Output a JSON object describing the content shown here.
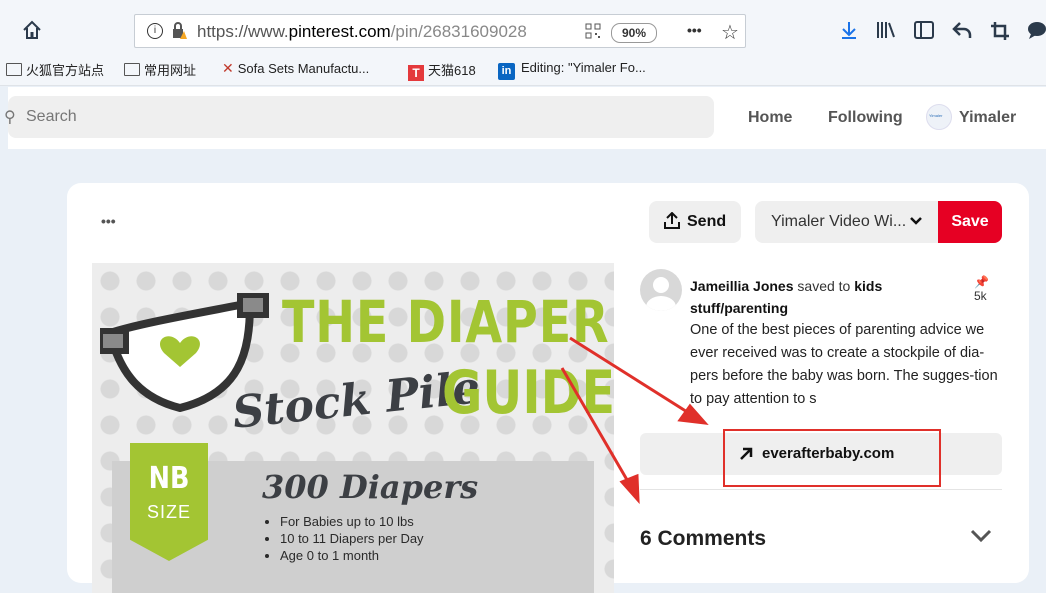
{
  "browser": {
    "url_prefix": "https://www.",
    "url_domain": "pinterest.com",
    "url_path": "/pin/26831609028",
    "zoom": "90%",
    "more": "•••"
  },
  "bookmarks": [
    {
      "label": "火狐官方站点",
      "icon": "folder-icon"
    },
    {
      "label": "常用网址",
      "icon": "folder-icon"
    },
    {
      "label": "Sofa Sets Manufactu...",
      "icon": "sofa-favicon"
    },
    {
      "label": "天猫618",
      "icon": "tmall-favicon",
      "badge": "T"
    },
    {
      "label": "Editing: \"Yimaler Fo...",
      "icon": "linkedin-favicon",
      "badge": "in"
    }
  ],
  "header": {
    "search_placeholder": "Search",
    "nav_home": "Home",
    "nav_following": "Following",
    "nav_profile": "Yimaler",
    "avatar_text": "Yimaler"
  },
  "pin_actions": {
    "more": "•••",
    "send": "Send",
    "board": "Yimaler Video Wi...",
    "save": "Save"
  },
  "pin_image": {
    "title_line1": "THE DIAPER",
    "title_script": "Stock Pile",
    "title_line2": "GUIDE",
    "badge_top": "NB",
    "badge_bottom": "SIZE",
    "count": "300 Diapers",
    "bullets": [
      "For Babies up to 10 lbs",
      "10 to 11 Diapers per Day",
      "Age 0 to 1 month"
    ]
  },
  "pin_meta": {
    "user": "Jameillia Jones",
    "saved_to": "saved to",
    "board_line1": "kids",
    "board_line2": "stuff/parenting",
    "pin_count": "5k",
    "description": "One of the best pieces of parenting advice we ever received was to create a stockpile of dia-pers before the baby was born. The sugges-tion to pay attention to s",
    "destination": "everafterbaby.com",
    "comments": "6 Comments"
  },
  "colors": {
    "save_red": "#e60023",
    "brand_green": "#a3c533",
    "annotation_red": "#e0302a"
  }
}
